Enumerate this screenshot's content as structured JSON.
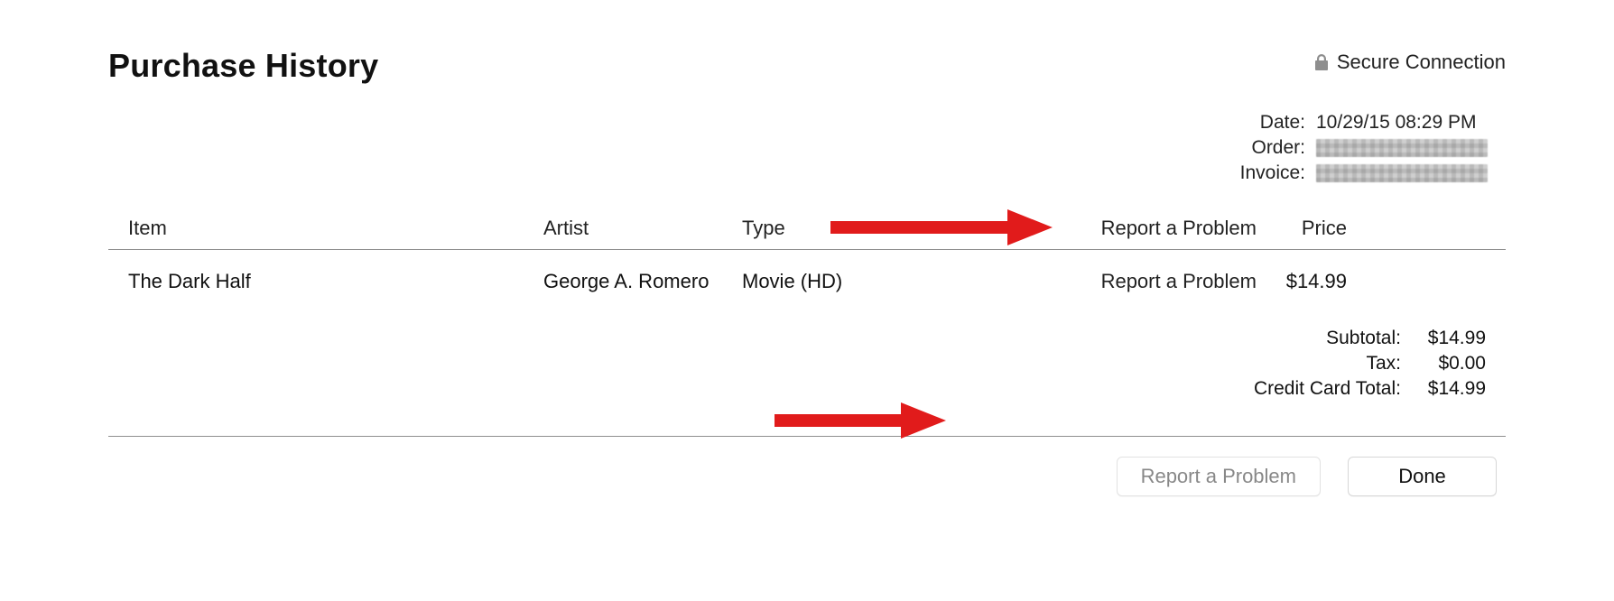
{
  "header": {
    "title": "Purchase History",
    "secure_label": "Secure Connection"
  },
  "meta": {
    "date_label": "Date:",
    "date_value": "10/29/15 08:29 PM",
    "order_label": "Order:",
    "invoice_label": "Invoice:"
  },
  "table": {
    "headers": {
      "item": "Item",
      "artist": "Artist",
      "type": "Type",
      "report": "Report a Problem",
      "price": "Price"
    },
    "rows": [
      {
        "item": "The Dark Half",
        "artist": "George A. Romero",
        "type": "Movie (HD)",
        "report": "Report a Problem",
        "price": "$14.99"
      }
    ]
  },
  "totals": {
    "subtotal_label": "Subtotal:",
    "subtotal_value": "$14.99",
    "tax_label": "Tax:",
    "tax_value": "$0.00",
    "cc_label": "Credit Card Total:",
    "cc_value": "$14.99"
  },
  "buttons": {
    "report": "Report a Problem",
    "done": "Done"
  }
}
